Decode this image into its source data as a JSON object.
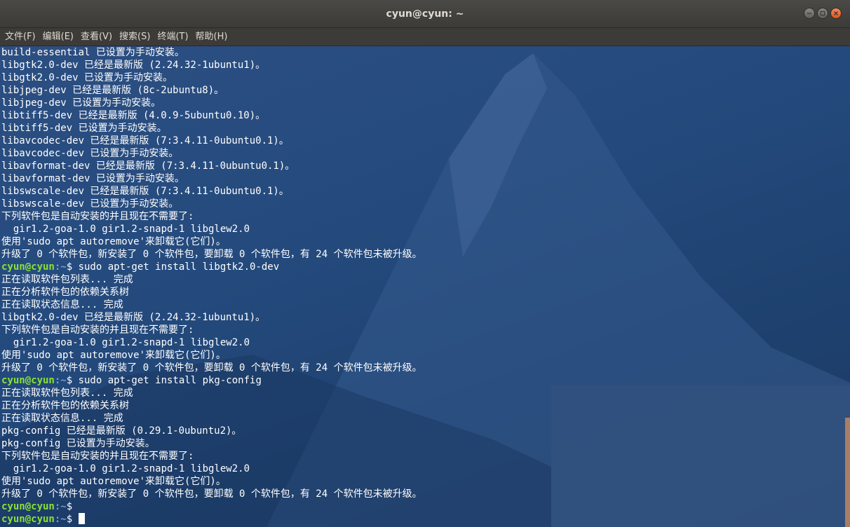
{
  "window": {
    "title": "cyun@cyun: ~"
  },
  "menu": {
    "items": [
      "文件(F)",
      "编辑(E)",
      "查看(V)",
      "搜索(S)",
      "终端(T)",
      "帮助(H)"
    ]
  },
  "terminal": {
    "lines": [
      {
        "type": "text",
        "text": "build-essential 已设置为手动安装。"
      },
      {
        "type": "text",
        "text": "libgtk2.0-dev 已经是最新版 (2.24.32-1ubuntu1)。"
      },
      {
        "type": "text",
        "text": "libgtk2.0-dev 已设置为手动安装。"
      },
      {
        "type": "text",
        "text": "libjpeg-dev 已经是最新版 (8c-2ubuntu8)。"
      },
      {
        "type": "text",
        "text": "libjpeg-dev 已设置为手动安装。"
      },
      {
        "type": "text",
        "text": "libtiff5-dev 已经是最新版 (4.0.9-5ubuntu0.10)。"
      },
      {
        "type": "text",
        "text": "libtiff5-dev 已设置为手动安装。"
      },
      {
        "type": "text",
        "text": "libavcodec-dev 已经是最新版 (7:3.4.11-0ubuntu0.1)。"
      },
      {
        "type": "text",
        "text": "libavcodec-dev 已设置为手动安装。"
      },
      {
        "type": "text",
        "text": "libavformat-dev 已经是最新版 (7:3.4.11-0ubuntu0.1)。"
      },
      {
        "type": "text",
        "text": "libavformat-dev 已设置为手动安装。"
      },
      {
        "type": "text",
        "text": "libswscale-dev 已经是最新版 (7:3.4.11-0ubuntu0.1)。"
      },
      {
        "type": "text",
        "text": "libswscale-dev 已设置为手动安装。"
      },
      {
        "type": "text",
        "text": "下列软件包是自动安装的并且现在不需要了:"
      },
      {
        "type": "text",
        "text": "  gir1.2-goa-1.0 gir1.2-snapd-1 libglew2.0"
      },
      {
        "type": "text",
        "text": "使用'sudo apt autoremove'来卸载它(它们)。"
      },
      {
        "type": "text",
        "text": "升级了 0 个软件包，新安装了 0 个软件包，要卸载 0 个软件包，有 24 个软件包未被升级。"
      },
      {
        "type": "prompt",
        "user": "cyun@cyun",
        "path": ":~",
        "cmd": "$ sudo apt-get install libgtk2.0-dev"
      },
      {
        "type": "text",
        "text": "正在读取软件包列表... 完成"
      },
      {
        "type": "text",
        "text": "正在分析软件包的依赖关系树"
      },
      {
        "type": "text",
        "text": "正在读取状态信息... 完成"
      },
      {
        "type": "text",
        "text": "libgtk2.0-dev 已经是最新版 (2.24.32-1ubuntu1)。"
      },
      {
        "type": "text",
        "text": "下列软件包是自动安装的并且现在不需要了:"
      },
      {
        "type": "text",
        "text": "  gir1.2-goa-1.0 gir1.2-snapd-1 libglew2.0"
      },
      {
        "type": "text",
        "text": "使用'sudo apt autoremove'来卸载它(它们)。"
      },
      {
        "type": "text",
        "text": "升级了 0 个软件包，新安装了 0 个软件包，要卸载 0 个软件包，有 24 个软件包未被升级。"
      },
      {
        "type": "prompt",
        "user": "cyun@cyun",
        "path": ":~",
        "cmd": "$ sudo apt-get install pkg-config"
      },
      {
        "type": "text",
        "text": "正在读取软件包列表... 完成"
      },
      {
        "type": "text",
        "text": "正在分析软件包的依赖关系树"
      },
      {
        "type": "text",
        "text": "正在读取状态信息... 完成"
      },
      {
        "type": "text",
        "text": "pkg-config 已经是最新版 (0.29.1-0ubuntu2)。"
      },
      {
        "type": "text",
        "text": "pkg-config 已设置为手动安装。"
      },
      {
        "type": "text",
        "text": "下列软件包是自动安装的并且现在不需要了:"
      },
      {
        "type": "text",
        "text": "  gir1.2-goa-1.0 gir1.2-snapd-1 libglew2.0"
      },
      {
        "type": "text",
        "text": "使用'sudo apt autoremove'来卸载它(它们)。"
      },
      {
        "type": "text",
        "text": "升级了 0 个软件包，新安装了 0 个软件包，要卸载 0 个软件包，有 24 个软件包未被升级。"
      },
      {
        "type": "prompt",
        "user": "cyun@cyun",
        "path": ":~",
        "cmd": "$"
      },
      {
        "type": "prompt",
        "user": "cyun@cyun",
        "path": ":~",
        "cmd": "$ ",
        "cursor": true
      }
    ]
  },
  "colors": {
    "prompt_user": "#8ae234",
    "prompt_path": "#729fcf",
    "terminal_text": "#ffffff",
    "titlebar": "#3c3b37",
    "close_button": "#e0531b"
  },
  "icons": {
    "minimize": "minimize-icon",
    "maximize": "maximize-icon",
    "close": "close-icon"
  }
}
